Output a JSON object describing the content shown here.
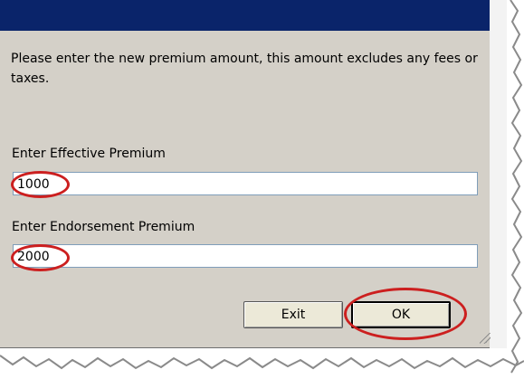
{
  "dialog": {
    "message": "Please enter the new premium amount, this amount excludes any fees or taxes.",
    "effective_label": "Enter Effective Premium",
    "effective_value": "1000",
    "endorsement_label": "Enter Endorsement Premium",
    "endorsement_value": "2000",
    "exit_label": "Exit",
    "ok_label": "OK"
  },
  "colors": {
    "titlebar": "#0a246a",
    "dialog_bg": "#d4d0c8",
    "highlight": "#cc1f1f"
  },
  "icons": [
    "resize-grip-icon"
  ]
}
